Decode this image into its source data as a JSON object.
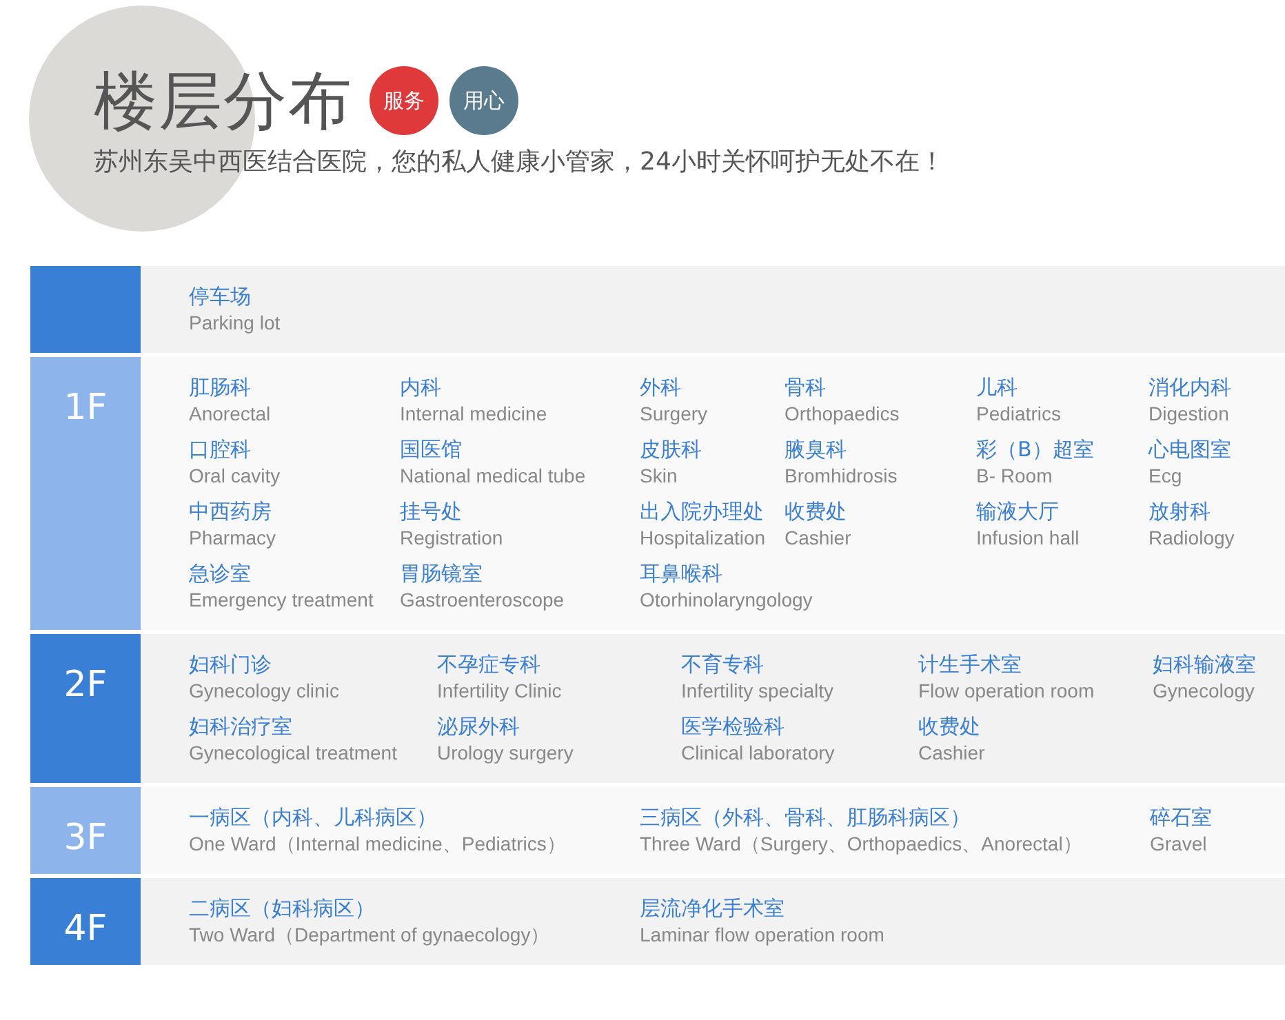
{
  "header": {
    "title": "楼层分布",
    "badges": [
      {
        "label": "服务",
        "color": "#e0393b"
      },
      {
        "label": "用心",
        "color": "#5a7a8e"
      }
    ],
    "subtitle": "苏州东吴中西医结合医院，您的私人健康小管家，24小时关怀呵护无处不在！"
  },
  "floors": [
    {
      "color": "#3a7fd6",
      "lines": [
        [
          {
            "zh": "停车场",
            "en": "Parking lot"
          }
        ]
      ]
    },
    {
      "label": "1F",
      "color": "#8db5ec",
      "lines": [
        [
          {
            "zh": "肛肠科",
            "en": "Anorectal"
          },
          {
            "zh": "内科",
            "en": "Internal medicine"
          },
          {
            "zh": "外科",
            "en": "Surgery"
          },
          {
            "zh": "骨科",
            "en": "Orthopaedics"
          },
          {
            "zh": "儿科",
            "en": "Pediatrics"
          },
          {
            "zh": "消化内科",
            "en": "Digestion"
          }
        ],
        [
          {
            "zh": "口腔科",
            "en": "Oral cavity"
          },
          {
            "zh": "国医馆",
            "en": "National medical tube"
          },
          {
            "zh": "皮肤科",
            "en": "Skin"
          },
          {
            "zh": "腋臭科",
            "en": "Bromhidrosis"
          },
          {
            "zh": "彩（B）超室",
            "en": "B- Room"
          },
          {
            "zh": "心电图室",
            "en": "Ecg"
          }
        ],
        [
          {
            "zh": "中西药房",
            "en": "Pharmacy"
          },
          {
            "zh": "挂号处",
            "en": "Registration"
          },
          {
            "zh": "出入院办理处",
            "en": "Hospitalization"
          },
          {
            "zh": "收费处",
            "en": "Cashier"
          },
          {
            "zh": "输液大厅",
            "en": "Infusion hall"
          },
          {
            "zh": "放射科",
            "en": "Radiology"
          }
        ],
        [
          {
            "zh": "急诊室",
            "en": "Emergency treatment"
          },
          {
            "zh": "胃肠镜室",
            "en": "Gastroenteroscope"
          },
          {
            "zh": "耳鼻喉科",
            "en": "Otorhinolaryngology"
          }
        ]
      ]
    },
    {
      "label": "2F",
      "color": "#3a7fd6",
      "lines": [
        [
          {
            "zh": "妇科门诊",
            "en": "Gynecology clinic"
          },
          {
            "zh": "不孕症专科",
            "en": "Infertility Clinic"
          },
          {
            "zh": "不育专科",
            "en": "Infertility specialty"
          },
          {
            "zh": "计生手术室",
            "en": "Flow operation room"
          },
          {
            "zh": "妇科输液室",
            "en": "Gynecology"
          }
        ],
        [
          {
            "zh": "妇科治疗室",
            "en": "Gynecological treatment"
          },
          {
            "zh": "泌尿外科",
            "en": "Urology surgery"
          },
          {
            "zh": "医学检验科",
            "en": "Clinical laboratory"
          },
          {
            "zh": "收费处",
            "en": "Cashier"
          }
        ]
      ]
    },
    {
      "label": "3F",
      "color": "#8db5ec",
      "lines": [
        [
          {
            "zh": "一病区（内科、儿科病区）",
            "en": "One Ward（Internal medicine、Pediatrics）"
          },
          {
            "zh": "三病区（外科、骨科、肛肠科病区）",
            "en": "Three Ward（Surgery、Orthopaedics、Anorectal）"
          },
          {
            "zh": "碎石室",
            "en": "Gravel"
          }
        ]
      ]
    },
    {
      "label": "4F",
      "color": "#3a7fd6",
      "lines": [
        [
          {
            "zh": "二病区（妇科病区）",
            "en": "Two Ward（Department of gynaecology）"
          },
          {
            "zh": "层流净化手术室",
            "en": "Laminar flow operation room"
          }
        ]
      ]
    }
  ]
}
